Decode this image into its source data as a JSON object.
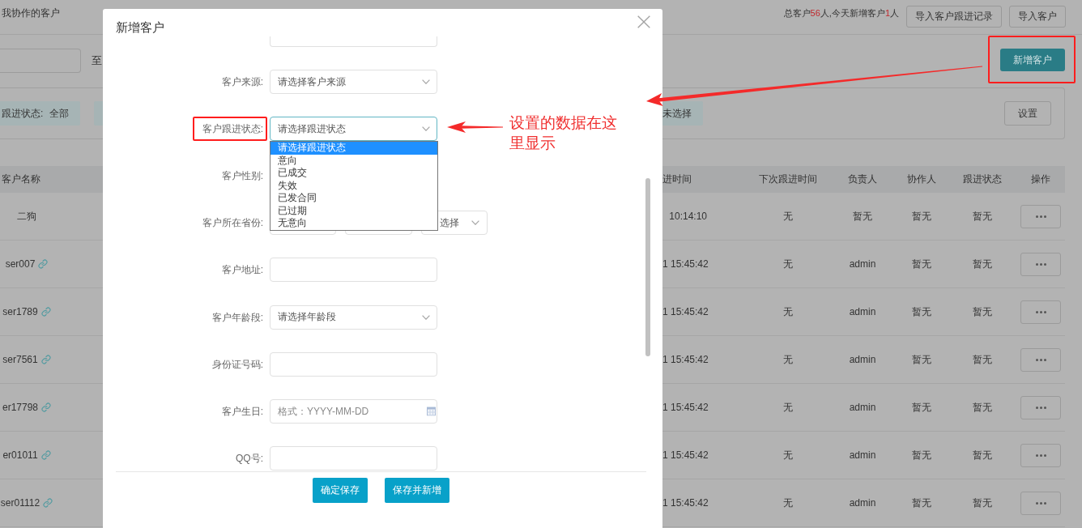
{
  "page": {
    "title": "我协作的客户",
    "stats": [
      {
        "kind": "text",
        "text": "总客户"
      },
      {
        "kind": "number",
        "text": "56"
      },
      {
        "kind": "text",
        "text": "人,今天新增客户"
      },
      {
        "kind": "number",
        "text": "1"
      },
      {
        "kind": "text",
        "text": "人"
      }
    ],
    "top_buttons": [
      {
        "label": "导入客户跟进记录"
      },
      {
        "label": "导入客户"
      }
    ],
    "date_separator": "至",
    "add_button": {
      "label": "新增客户",
      "highlighted": true
    },
    "filters": [
      {
        "label": "跟进状态:",
        "value": "全部"
      },
      {
        "value": "未选择"
      }
    ],
    "settings_button": "设置"
  },
  "table": {
    "columns": [
      "客户名称",
      "进时间",
      "下次跟进时间",
      "负责人",
      "协作人",
      "跟进状态",
      "操作"
    ],
    "rows": [
      {
        "name": "二狗",
        "linked": false,
        "time": "10:14:10",
        "next": "无",
        "owner": "暂无",
        "collaborator": "暂无",
        "status": "暂无"
      },
      {
        "name": "ser007",
        "linked": true,
        "time": "1 15:45:42",
        "next": "无",
        "owner": "admin",
        "collaborator": "暂无",
        "status": "暂无"
      },
      {
        "name": "ser1789",
        "linked": true,
        "time": "1 15:45:42",
        "next": "无",
        "owner": "admin",
        "collaborator": "暂无",
        "status": "暂无"
      },
      {
        "name": "ser7561",
        "linked": true,
        "time": "1 15:45:42",
        "next": "无",
        "owner": "admin",
        "collaborator": "暂无",
        "status": "暂无"
      },
      {
        "name": "er17798",
        "linked": true,
        "time": "1 15:45:42",
        "next": "无",
        "owner": "admin",
        "collaborator": "暂无",
        "status": "暂无"
      },
      {
        "name": "er01011",
        "linked": true,
        "time": "1 15:45:42",
        "next": "无",
        "owner": "admin",
        "collaborator": "暂无",
        "status": "暂无"
      },
      {
        "name": "ser01112",
        "linked": true,
        "time": "1 15:45:42",
        "next": "无",
        "owner": "admin",
        "collaborator": "暂无",
        "status": "暂无"
      }
    ]
  },
  "dialog": {
    "title": "新增客户",
    "fields": [
      {
        "kind": "partial",
        "focused": false
      },
      {
        "kind": "select",
        "label": "客户来源:",
        "placeholder": "请选择客户来源",
        "highlighted": false,
        "focused": false
      },
      {
        "kind": "select",
        "label": "客户跟进状态:",
        "placeholder": "请选择跟进状态",
        "highlighted": true,
        "focused": true,
        "options": [
          {
            "label": "请选择跟进状态",
            "selected": true
          },
          {
            "label": "意向",
            "selected": false
          },
          {
            "label": "已成交",
            "selected": false
          },
          {
            "label": "失效",
            "selected": false
          },
          {
            "label": "已发合同",
            "selected": false
          },
          {
            "label": "已过期",
            "selected": false
          },
          {
            "label": "无意向",
            "selected": false
          }
        ]
      },
      {
        "kind": "none",
        "label": "客户性别:",
        "highlighted": false
      },
      {
        "kind": "province",
        "label": "客户所在省份:",
        "placeholder": "选择",
        "highlighted": false,
        "focused": false
      },
      {
        "kind": "input",
        "label": "客户地址:",
        "highlighted": false,
        "focused": false
      },
      {
        "kind": "select",
        "label": "客户年龄段:",
        "placeholder": "请选择年龄段",
        "highlighted": false,
        "focused": false
      },
      {
        "kind": "input",
        "label": "身份证号码:",
        "highlighted": false,
        "focused": false
      },
      {
        "kind": "date",
        "label": "客户生日:",
        "placeholder": "格式：YYYY-MM-DD",
        "highlighted": false,
        "focused": false
      },
      {
        "kind": "input",
        "label": "QQ号:",
        "highlighted": false,
        "focused": false
      }
    ],
    "buttons": [
      {
        "label": "确定保存"
      },
      {
        "label": "保存并新增"
      }
    ]
  },
  "annotation": {
    "note": "设置的数据在这里显示"
  }
}
